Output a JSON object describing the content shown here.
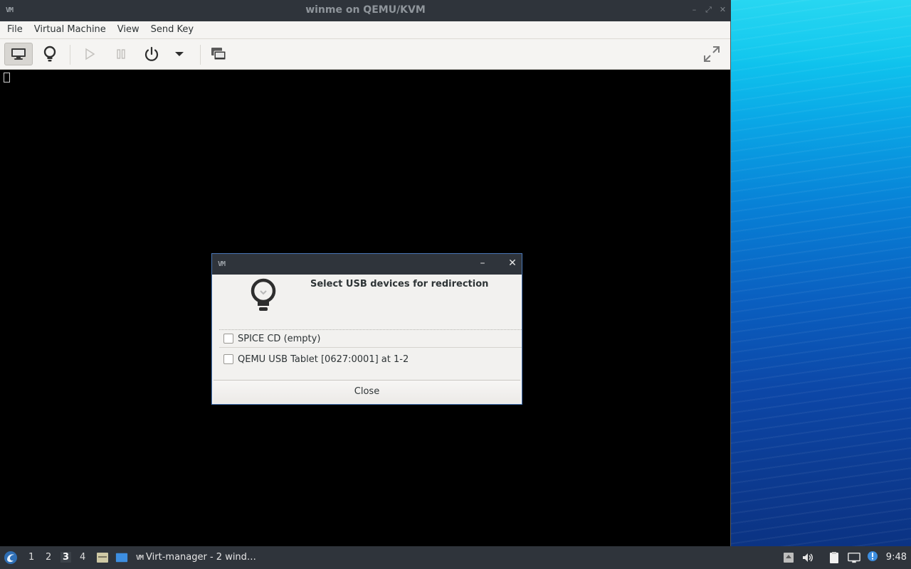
{
  "window": {
    "title": "winme on QEMU/KVM",
    "app_logo": "VM"
  },
  "menubar": {
    "items": [
      "File",
      "Virtual Machine",
      "View",
      "Send Key"
    ]
  },
  "toolbar": {
    "buttons": [
      "console-icon",
      "details-bulb-icon",
      "run-icon",
      "pause-icon",
      "power-icon",
      "dropdown-arrow-icon",
      "snapshots-icon",
      "fullscreen-icon"
    ]
  },
  "dialog": {
    "heading": "Select USB devices for redirection",
    "devices": [
      {
        "label": "SPICE CD (empty)",
        "checked": false
      },
      {
        "label": "QEMU USB Tablet [0627:0001] at 1-2",
        "checked": false
      }
    ],
    "close_label": "Close",
    "min_glyph": "–",
    "close_glyph": "✕"
  },
  "taskbar": {
    "workspaces": [
      "1",
      "2",
      "3",
      "4"
    ],
    "active_workspace": "3",
    "task_label": "Virt-manager - 2 wind…",
    "clock": "9:48"
  },
  "colors": {
    "titlebar": "#2f343b",
    "panel": "#f5f4f2",
    "accent_border": "#4a78b8"
  }
}
